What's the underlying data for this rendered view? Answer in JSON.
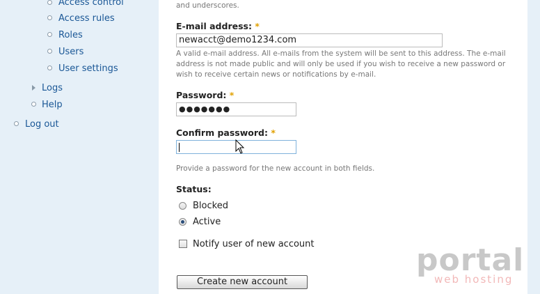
{
  "sidebar": {
    "items": [
      {
        "label": "Access control"
      },
      {
        "label": "Access rules"
      },
      {
        "label": "Roles"
      },
      {
        "label": "Users"
      },
      {
        "label": "User settings"
      },
      {
        "label": "Logs"
      },
      {
        "label": "Help"
      },
      {
        "label": "Log out"
      }
    ]
  },
  "form": {
    "username_desc_tail": "and underscores.",
    "email": {
      "label": "E-mail address:",
      "required_marker": "*",
      "value": "newacct@demo1234.com",
      "desc": "A valid e-mail address. All e-mails from the system will be sent to this address. The e-mail address is not made public and will only be used if you wish to receive a new password or wish to receive certain news or notifications by e-mail."
    },
    "password": {
      "label": "Password:",
      "required_marker": "*",
      "masked_value": "●●●●●●●"
    },
    "confirm_password": {
      "label": "Confirm password:",
      "required_marker": "*",
      "value": ""
    },
    "password_desc": "Provide a password for the new account in both fields.",
    "status": {
      "label": "Status:",
      "options": [
        "Blocked",
        "Active"
      ],
      "selected": "Active"
    },
    "notify": {
      "label": "Notify user of new account",
      "checked": false
    },
    "submit_label": "Create new account"
  },
  "watermark": {
    "brand": "portal",
    "tagline": "web hosting"
  }
}
